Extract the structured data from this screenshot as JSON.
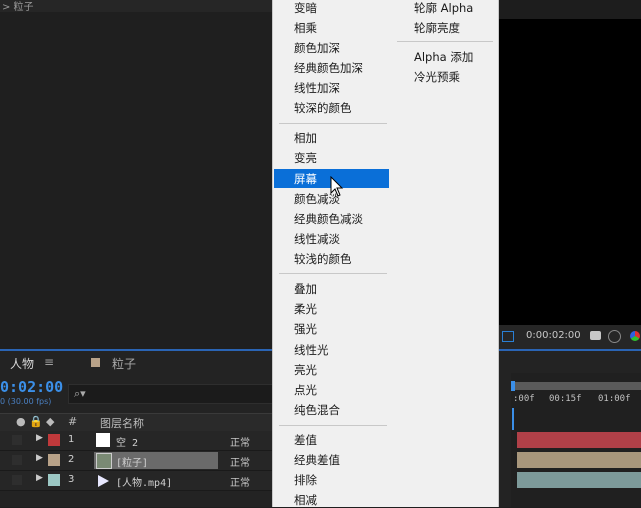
{
  "top_strip": {
    "title": "> 粒子"
  },
  "timeline": {
    "tabs": [
      {
        "label": "人物",
        "menu_icon": "≡"
      },
      {
        "label": "粒子"
      }
    ],
    "timecode": "0:02:00",
    "fps": "0 (30.00 fps)",
    "columns": {
      "num": "#",
      "layer_name": "图层名称"
    },
    "layers": [
      {
        "num": "1",
        "name": "空 2",
        "mode": "正常",
        "label_color": "#c0393b",
        "thumb": "solid-white"
      },
      {
        "num": "2",
        "name": "[粒子]",
        "mode": "正常",
        "label_color": "#b8a288",
        "thumb": "comp"
      },
      {
        "num": "3",
        "name": "[人物.mp4]",
        "mode": "正常",
        "label_color": "#9cc8c4",
        "thumb": "video"
      }
    ],
    "ruler_labels": [
      ":00f",
      "00:15f",
      "01:00f"
    ],
    "bar_colors": [
      "#b04048",
      "#a8977c",
      "#7d9a9a"
    ]
  },
  "viewer": {
    "timecode": "0:00:02:00"
  },
  "blend_menu": {
    "groups": [
      [
        "变暗",
        "相乘",
        "颜色加深",
        "经典颜色加深",
        "线性加深",
        "较深的颜色"
      ],
      [
        "相加",
        "变亮",
        "屏幕",
        "颜色减淡",
        "经典颜色减淡",
        "线性减淡",
        "较浅的颜色"
      ],
      [
        "叠加",
        "柔光",
        "强光",
        "线性光",
        "亮光",
        "点光",
        "纯色混合"
      ],
      [
        "差值",
        "经典差值",
        "排除",
        "相减"
      ]
    ],
    "highlighted": "屏幕"
  },
  "blend_menu_col2": {
    "groups": [
      [
        "轮廓 Alpha",
        "轮廓亮度"
      ],
      [
        "Alpha 添加",
        "冷光预乘"
      ]
    ]
  }
}
